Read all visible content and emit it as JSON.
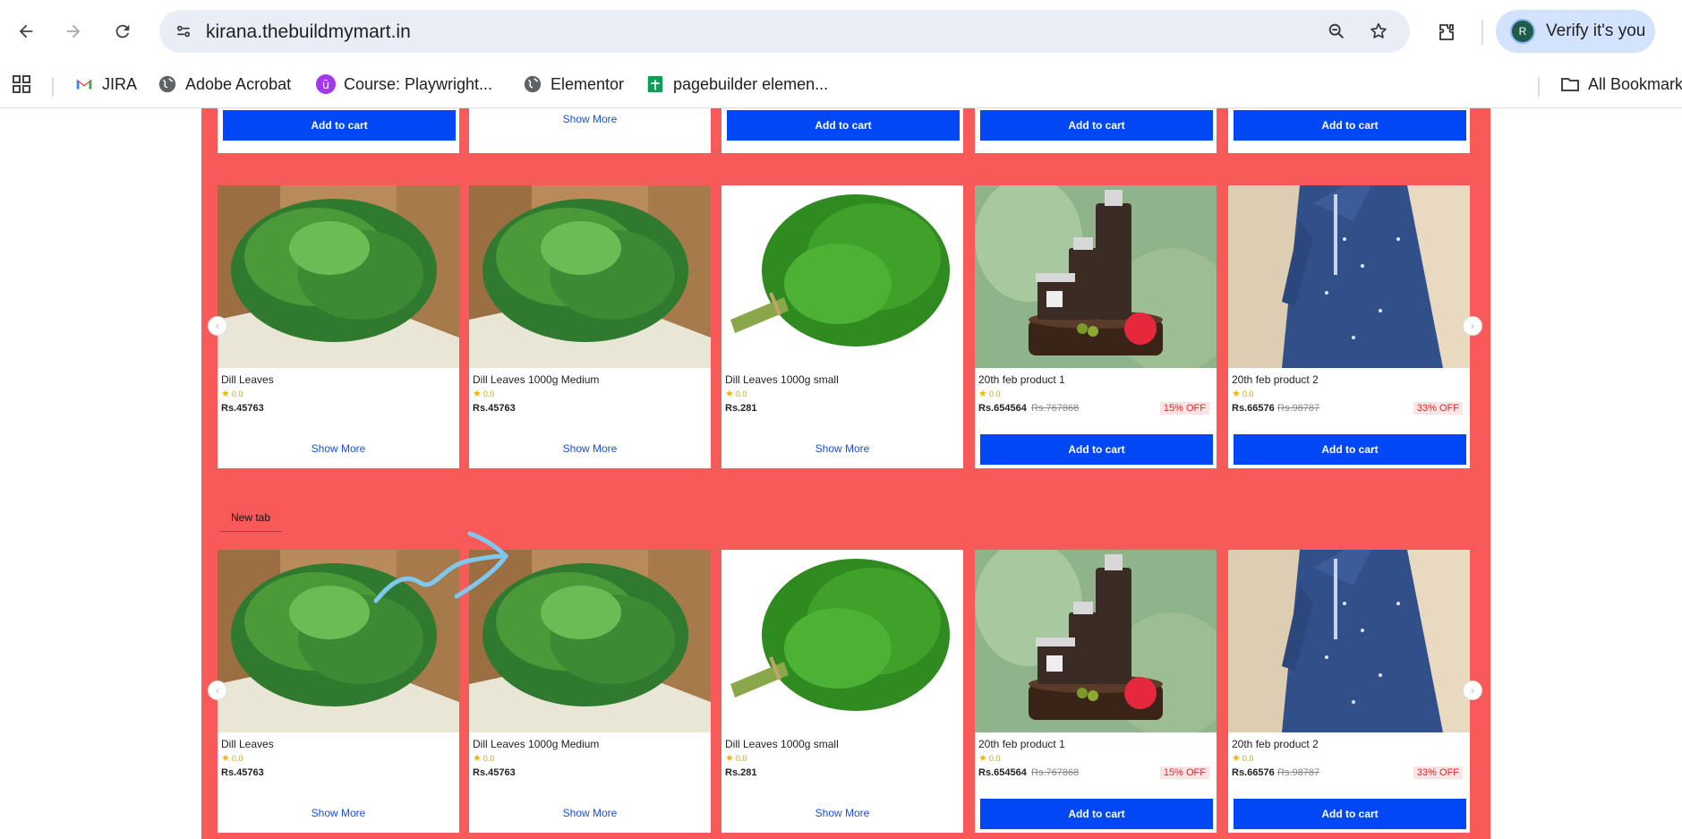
{
  "browser": {
    "url": "kirana.thebuildmymart.in",
    "profile_label": "Verify it's you",
    "profile_initial": "R",
    "bookmarks": [
      {
        "label": "JIRA",
        "icon": "gmail-icon"
      },
      {
        "label": "Adobe Acrobat",
        "icon": "globe-icon"
      },
      {
        "label": "Course: Playwright...",
        "icon": "course-icon"
      },
      {
        "label": "Elementor",
        "icon": "globe-icon"
      },
      {
        "label": "pagebuilder elemen...",
        "icon": "sheets-icon"
      }
    ],
    "all_bookmarks_label": "All Bookmarks"
  },
  "top_row": {
    "cards": [
      {
        "button": "Add to cart"
      },
      {
        "button": "Show More"
      },
      {
        "button": "Add to cart"
      },
      {
        "button": "Add to cart"
      },
      {
        "button": "Add to cart"
      }
    ]
  },
  "tab_label": "New tab",
  "rows": [
    {
      "products": [
        {
          "name": "Dill Leaves",
          "rating": "0.0",
          "price": "Rs.45763",
          "mrp": "",
          "off": "",
          "action": "Show More",
          "image": "dill"
        },
        {
          "name": "Dill Leaves 1000g Medium",
          "rating": "0.0",
          "price": "Rs.45763",
          "mrp": "",
          "off": "",
          "action": "Show More",
          "image": "dill"
        },
        {
          "name": "Dill Leaves 1000g small",
          "rating": "0.0",
          "price": "Rs.281",
          "mrp": "",
          "off": "",
          "action": "Show More",
          "image": "dill-bunch"
        },
        {
          "name": "20th feb product 1",
          "rating": "0.0",
          "price": "Rs.654564",
          "mrp": "Rs.767868",
          "off": "15% OFF",
          "action": "Add to cart",
          "image": "cosmetics"
        },
        {
          "name": "20th feb product 2",
          "rating": "0.0",
          "price": "Rs.66576",
          "mrp": "Rs.98787",
          "off": "33% OFF",
          "action": "Add to cart",
          "image": "dress"
        }
      ]
    },
    {
      "products": [
        {
          "name": "Dill Leaves",
          "rating": "0.0",
          "price": "Rs.45763",
          "mrp": "",
          "off": "",
          "action": "Show More",
          "image": "dill"
        },
        {
          "name": "Dill Leaves 1000g Medium",
          "rating": "0.0",
          "price": "Rs.45763",
          "mrp": "",
          "off": "",
          "action": "Show More",
          "image": "dill"
        },
        {
          "name": "Dill Leaves 1000g small",
          "rating": "0.0",
          "price": "Rs.281",
          "mrp": "",
          "off": "",
          "action": "Show More",
          "image": "dill-bunch"
        },
        {
          "name": "20th feb product 1",
          "rating": "0.0",
          "price": "Rs.654564",
          "mrp": "Rs.767868",
          "off": "15% OFF",
          "action": "Add to cart",
          "image": "cosmetics"
        },
        {
          "name": "20th feb product 2",
          "rating": "0.0",
          "price": "Rs.66576",
          "mrp": "Rs.98787",
          "off": "33% OFF",
          "action": "Add to cart",
          "image": "dress"
        }
      ]
    }
  ],
  "colors": {
    "panel": "#f85a5a",
    "button": "#0047f5",
    "link": "#1a4fd8",
    "off_badge": "#e02424"
  }
}
